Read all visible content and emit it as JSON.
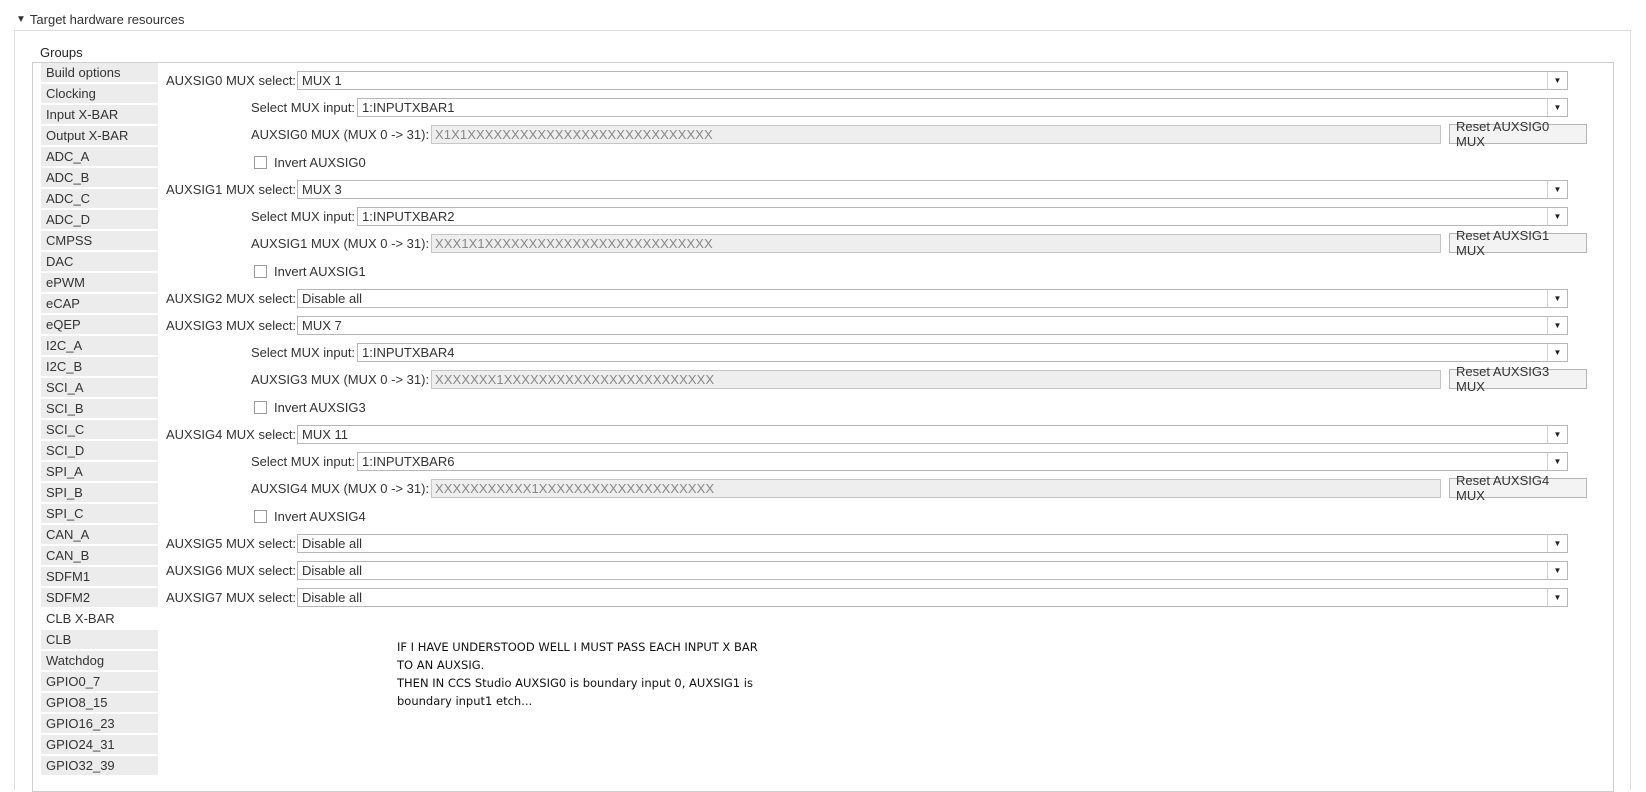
{
  "section": {
    "title": "Target hardware resources"
  },
  "groups": {
    "title": "Groups",
    "items": [
      "Build options",
      "Clocking",
      "Input X-BAR",
      "Output X-BAR",
      "ADC_A",
      "ADC_B",
      "ADC_C",
      "ADC_D",
      "CMPSS",
      "DAC",
      "ePWM",
      "eCAP",
      "eQEP",
      "I2C_A",
      "I2C_B",
      "SCI_A",
      "SCI_B",
      "SCI_C",
      "SCI_D",
      "SPI_A",
      "SPI_B",
      "SPI_C",
      "CAN_A",
      "CAN_B",
      "SDFM1",
      "SDFM2",
      "CLB X-BAR",
      "CLB",
      "Watchdog",
      "GPIO0_7",
      "GPIO8_15",
      "GPIO16_23",
      "GPIO24_31",
      "GPIO32_39"
    ],
    "selected": "CLB X-BAR"
  },
  "aux": {
    "sig0": {
      "mux_label": "AUXSIG0 MUX select:",
      "mux_value": "MUX 1",
      "input_label": "Select MUX input:",
      "input_value": "1:INPUTXBAR1",
      "mask_label": "AUXSIG0 MUX (MUX 0 -> 31):",
      "mask_value": "X1X1XXXXXXXXXXXXXXXXXXXXXXXXXXXX",
      "reset_label": "Reset AUXSIG0 MUX",
      "invert_label": "Invert AUXSIG0"
    },
    "sig1": {
      "mux_label": "AUXSIG1 MUX select:",
      "mux_value": "MUX 3",
      "input_label": "Select MUX input:",
      "input_value": "1:INPUTXBAR2",
      "mask_label": "AUXSIG1 MUX (MUX 0 -> 31):",
      "mask_value": "XXX1X1XXXXXXXXXXXXXXXXXXXXXXXXXX",
      "reset_label": "Reset AUXSIG1 MUX",
      "invert_label": "Invert AUXSIG1"
    },
    "sig2": {
      "mux_label": "AUXSIG2 MUX select:",
      "mux_value": "Disable all"
    },
    "sig3": {
      "mux_label": "AUXSIG3 MUX select:",
      "mux_value": "MUX 7",
      "input_label": "Select MUX input:",
      "input_value": "1:INPUTXBAR4",
      "mask_label": "AUXSIG3 MUX (MUX 0 -> 31):",
      "mask_value": "XXXXXXX1XXXXXXXXXXXXXXXXXXXXXXXX",
      "reset_label": "Reset AUXSIG3 MUX",
      "invert_label": "Invert AUXSIG3"
    },
    "sig4": {
      "mux_label": "AUXSIG4 MUX select:",
      "mux_value": "MUX 11",
      "input_label": "Select MUX input:",
      "input_value": "1:INPUTXBAR6",
      "mask_label": "AUXSIG4 MUX (MUX 0 -> 31):",
      "mask_value": "XXXXXXXXXXX1XXXXXXXXXXXXXXXXXXXX",
      "reset_label": "Reset AUXSIG4 MUX",
      "invert_label": "Invert AUXSIG4"
    },
    "sig5": {
      "mux_label": "AUXSIG5 MUX select:",
      "mux_value": "Disable all"
    },
    "sig6": {
      "mux_label": "AUXSIG6 MUX select:",
      "mux_value": "Disable all"
    },
    "sig7": {
      "mux_label": "AUXSIG7 MUX select:",
      "mux_value": "Disable all"
    }
  },
  "note": {
    "line1": "IF I HAVE UNDERSTOOD WELL I MUST PASS EACH INPUT X BAR",
    "line2": "TO AN AUXSIG.",
    "line3": "THEN IN CCS Studio AUXSIG0 is boundary input 0, AUXSIG1 is",
    "line4": "boundary input1 etch..."
  }
}
